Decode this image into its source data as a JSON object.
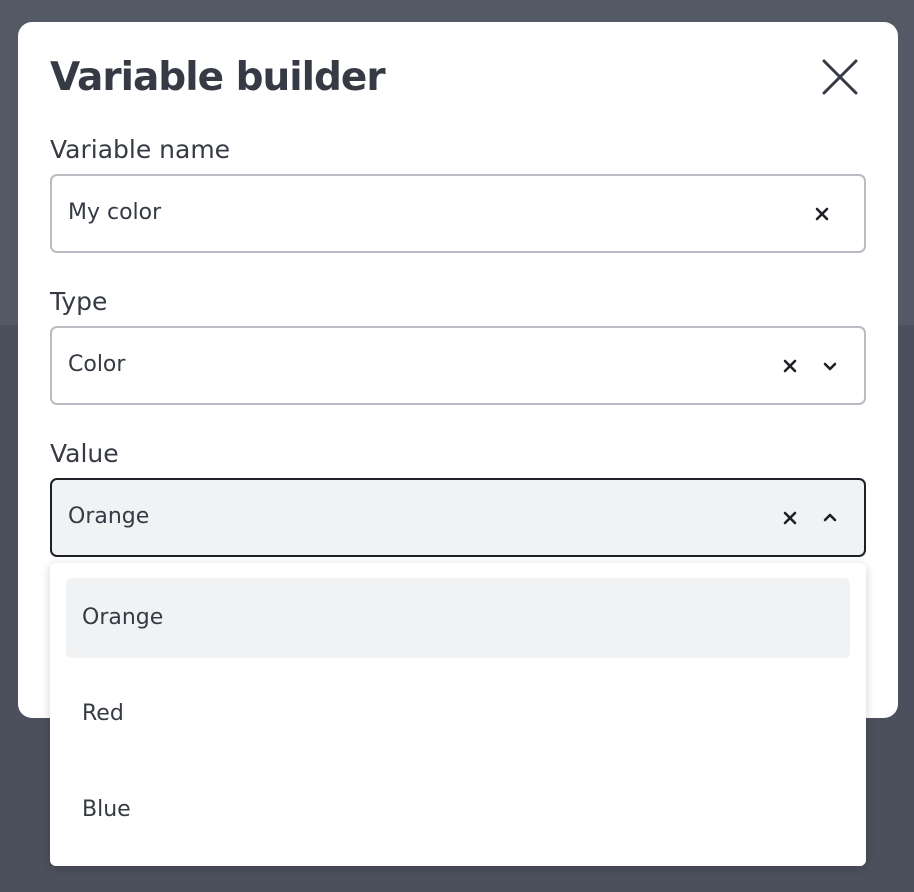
{
  "modal": {
    "title": "Variable builder"
  },
  "fields": {
    "name": {
      "label": "Variable name",
      "value": "My color"
    },
    "type": {
      "label": "Type",
      "value": "Color"
    },
    "value": {
      "label": "Value",
      "value": "Orange"
    }
  },
  "dropdown": {
    "options": [
      "Orange",
      "Red",
      "Blue"
    ],
    "selected": "Orange"
  },
  "colors": {
    "backdrop": "#545966",
    "text": "#363a44",
    "field_border": "#b9bcc3",
    "active_border": "#1d2027",
    "highlight": "#f1f2f4"
  },
  "icons": {
    "close": "close-icon",
    "clear": "clear-icon",
    "chevron_down": "chevron-down-icon",
    "chevron_up": "chevron-up-icon"
  }
}
